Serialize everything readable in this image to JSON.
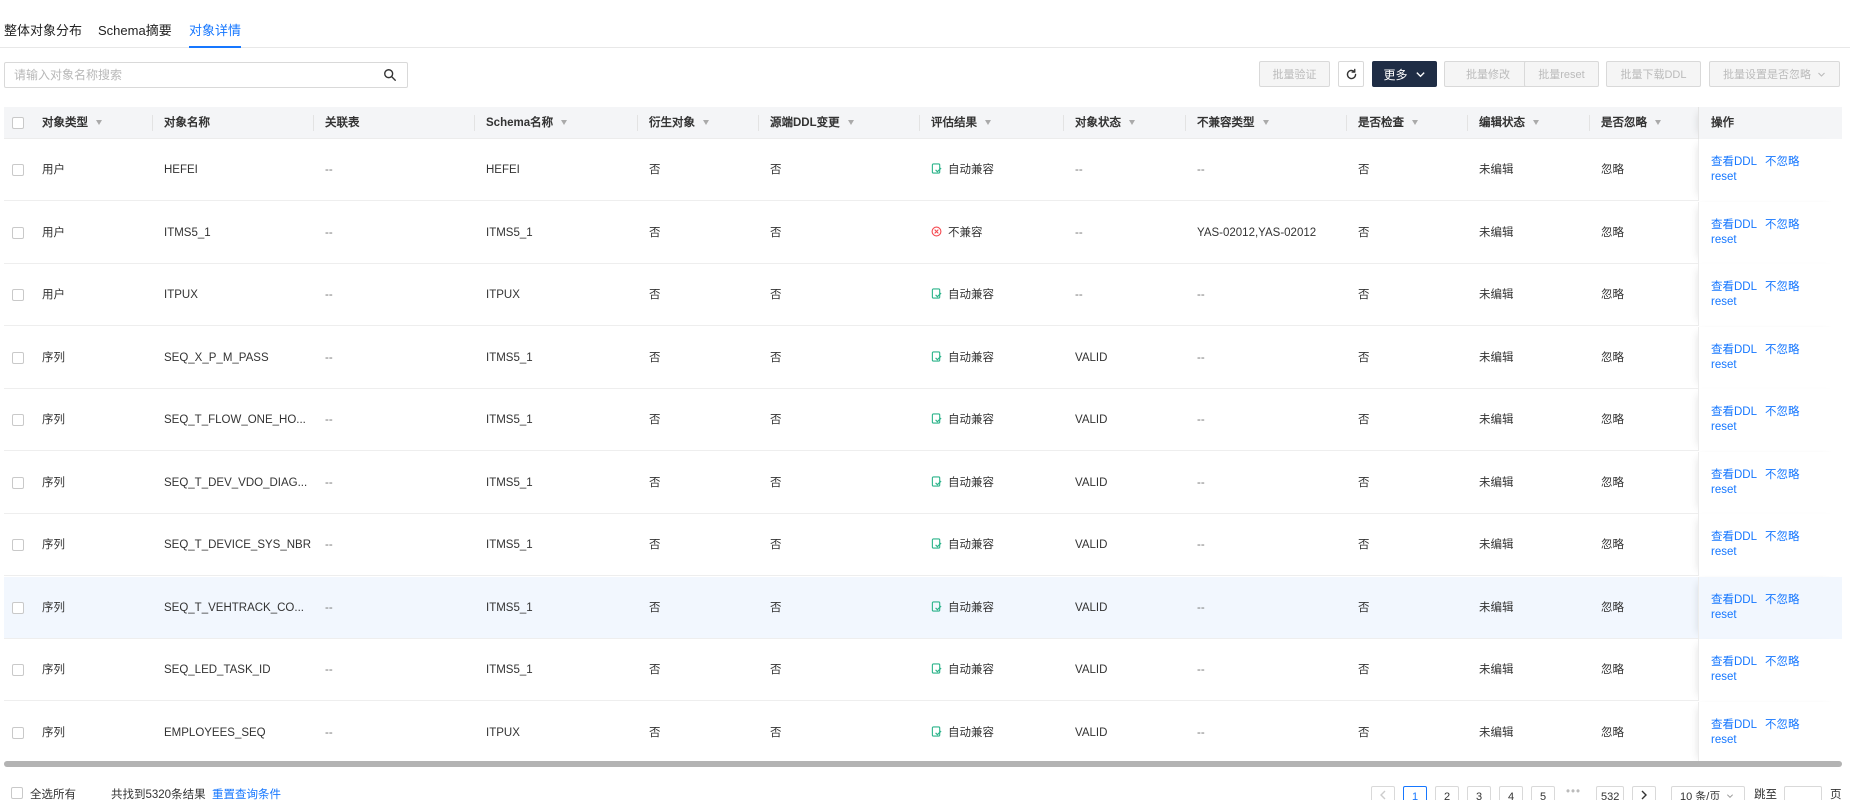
{
  "tabs": [
    {
      "label": "整体对象分布"
    },
    {
      "label": "Schema摘要"
    },
    {
      "label": "对象详情"
    }
  ],
  "active_tab": 2,
  "search": {
    "placeholder": "请输入对象名称搜索",
    "value": ""
  },
  "toolbar": {
    "batch_verify": "批量验证",
    "more": "更多",
    "batch_modify": "批量修改",
    "batch_reset": "批量reset",
    "batch_download_ddl": "批量下载DDL",
    "batch_set_ignore": "批量设置是否忽略"
  },
  "columns": [
    {
      "label": "对象类型",
      "filter": true
    },
    {
      "label": "对象名称",
      "filter": false
    },
    {
      "label": "关联表",
      "filter": false
    },
    {
      "label": "Schema名称",
      "filter": true
    },
    {
      "label": "衍生对象",
      "filter": true
    },
    {
      "label": "源端DDL变更",
      "filter": true
    },
    {
      "label": "评估结果",
      "filter": true
    },
    {
      "label": "对象状态",
      "filter": true
    },
    {
      "label": "不兼容类型",
      "filter": true
    },
    {
      "label": "是否检查",
      "filter": true
    },
    {
      "label": "编辑状态",
      "filter": true
    },
    {
      "label": "是否忽略",
      "filter": true
    }
  ],
  "ops_header": "操作",
  "rows": [
    {
      "type": "用户",
      "name": "HEFEI",
      "rel": "--",
      "schema": "HEFEI",
      "derived": "否",
      "ddl": "否",
      "result": "自动兼容",
      "ok": true,
      "status": "--",
      "incompat": "--",
      "check": "否",
      "edit": "未编辑",
      "ignore": "忽略",
      "op1": "查看DDL",
      "op2": "不忽略",
      "op3": "reset"
    },
    {
      "type": "用户",
      "name": "ITMS5_1",
      "rel": "--",
      "schema": "ITMS5_1",
      "derived": "否",
      "ddl": "否",
      "result": "不兼容",
      "ok": false,
      "status": "--",
      "incompat": "YAS-02012,YAS-02012",
      "check": "否",
      "edit": "未编辑",
      "ignore": "忽略",
      "op1": "查看DDL",
      "op2": "不忽略",
      "op3": "reset"
    },
    {
      "type": "用户",
      "name": "ITPUX",
      "rel": "--",
      "schema": "ITPUX",
      "derived": "否",
      "ddl": "否",
      "result": "自动兼容",
      "ok": true,
      "status": "--",
      "incompat": "--",
      "check": "否",
      "edit": "未编辑",
      "ignore": "忽略",
      "op1": "查看DDL",
      "op2": "不忽略",
      "op3": "reset"
    },
    {
      "type": "序列",
      "name": "SEQ_X_P_M_PASS",
      "rel": "--",
      "schema": "ITMS5_1",
      "derived": "否",
      "ddl": "否",
      "result": "自动兼容",
      "ok": true,
      "status": "VALID",
      "incompat": "--",
      "check": "否",
      "edit": "未编辑",
      "ignore": "忽略",
      "op1": "查看DDL",
      "op2": "不忽略",
      "op3": "reset"
    },
    {
      "type": "序列",
      "name": "SEQ_T_FLOW_ONE_HO...",
      "rel": "--",
      "schema": "ITMS5_1",
      "derived": "否",
      "ddl": "否",
      "result": "自动兼容",
      "ok": true,
      "status": "VALID",
      "incompat": "--",
      "check": "否",
      "edit": "未编辑",
      "ignore": "忽略",
      "op1": "查看DDL",
      "op2": "不忽略",
      "op3": "reset"
    },
    {
      "type": "序列",
      "name": "SEQ_T_DEV_VDO_DIAG...",
      "rel": "--",
      "schema": "ITMS5_1",
      "derived": "否",
      "ddl": "否",
      "result": "自动兼容",
      "ok": true,
      "status": "VALID",
      "incompat": "--",
      "check": "否",
      "edit": "未编辑",
      "ignore": "忽略",
      "op1": "查看DDL",
      "op2": "不忽略",
      "op3": "reset"
    },
    {
      "type": "序列",
      "name": "SEQ_T_DEVICE_SYS_NBR",
      "rel": "--",
      "schema": "ITMS5_1",
      "derived": "否",
      "ddl": "否",
      "result": "自动兼容",
      "ok": true,
      "status": "VALID",
      "incompat": "--",
      "check": "否",
      "edit": "未编辑",
      "ignore": "忽略",
      "op1": "查看DDL",
      "op2": "不忽略",
      "op3": "reset"
    },
    {
      "type": "序列",
      "name": "SEQ_T_VEHTRACK_CO...",
      "rel": "--",
      "schema": "ITMS5_1",
      "derived": "否",
      "ddl": "否",
      "result": "自动兼容",
      "ok": true,
      "status": "VALID",
      "incompat": "--",
      "check": "否",
      "edit": "未编辑",
      "ignore": "忽略",
      "op1": "查看DDL",
      "op2": "不忽略",
      "op3": "reset"
    },
    {
      "type": "序列",
      "name": "SEQ_LED_TASK_ID",
      "rel": "--",
      "schema": "ITMS5_1",
      "derived": "否",
      "ddl": "否",
      "result": "自动兼容",
      "ok": true,
      "status": "VALID",
      "incompat": "--",
      "check": "否",
      "edit": "未编辑",
      "ignore": "忽略",
      "op1": "查看DDL",
      "op2": "不忽略",
      "op3": "reset"
    },
    {
      "type": "序列",
      "name": "EMPLOYEES_SEQ",
      "rel": "--",
      "schema": "ITPUX",
      "derived": "否",
      "ddl": "否",
      "result": "自动兼容",
      "ok": true,
      "status": "VALID",
      "incompat": "--",
      "check": "否",
      "edit": "未编辑",
      "ignore": "忽略",
      "op1": "查看DDL",
      "op2": "不忽略",
      "op3": "reset"
    }
  ],
  "hover_row": 7,
  "footer": {
    "select_all": "全选所有",
    "result_count": "共找到5320条结果",
    "reset_query": "重置查询条件",
    "pages": [
      "1",
      "2",
      "3",
      "4",
      "5",
      "•••",
      "532"
    ],
    "current_page": "1",
    "page_size": "10 条/页",
    "jump_label": "跳至",
    "jump_value": "",
    "page_unit": "页"
  },
  "colors": {
    "accent": "#1677ff",
    "ok": "#2bb38a",
    "error": "#f5484f",
    "primary_button": "#1f2d45"
  },
  "icons": {
    "search": "search-icon",
    "refresh": "refresh-icon",
    "more_chevron": "chevron-down-icon",
    "compatible": "compatible-check-icon",
    "incompatible": "error-circle-icon",
    "filter": "filter-icon",
    "prev": "chevron-left-icon",
    "next": "chevron-right-icon"
  }
}
